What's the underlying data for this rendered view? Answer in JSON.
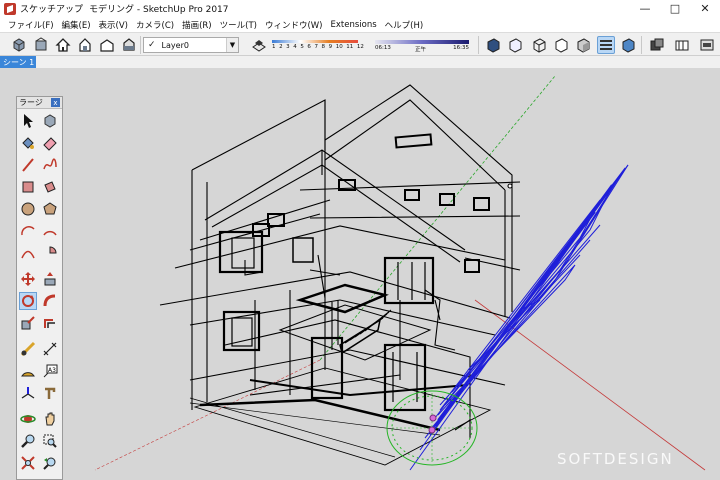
{
  "window": {
    "title_parts": [
      "スケッチアップ",
      "モデリング - SketchUp Pro 2017"
    ],
    "controls": [
      "—",
      "□",
      "✕"
    ]
  },
  "menu": [
    "ファイル(F)",
    "編集(E)",
    "表示(V)",
    "カメラ(C)",
    "描画(R)",
    "ツール(T)",
    "ウィンドウ(W)",
    "Extensions",
    "ヘルプ(H)"
  ],
  "toolbar": {
    "layer_value": "Layer0",
    "shadow_scale_labels": [
      "1",
      "2",
      "3",
      "4",
      "5",
      "6",
      "7",
      "8",
      "9",
      "10",
      "11",
      "12"
    ],
    "time_start": "06:13",
    "time_mid": "正午",
    "time_end": "16:35"
  },
  "scenes": {
    "tabs": [
      "シーン 1"
    ]
  },
  "palette": {
    "title": "ラージ",
    "close_label": "x",
    "tools": [
      "select-icon",
      "component-icon",
      "paint-bucket-icon",
      "eraser-icon",
      "line-icon",
      "freehand-icon",
      "rectangle-icon",
      "rotated-rectangle-icon",
      "circle-icon",
      "polygon-icon",
      "arc-icon",
      "two-point-arc-icon",
      "three-point-arc-icon",
      "pie-icon",
      "move-icon",
      "push-pull-icon",
      "rotate-icon",
      "follow-me-icon",
      "scale-icon",
      "offset-icon",
      "tape-measure-icon",
      "dimension-icon",
      "protractor-icon",
      "text-icon",
      "axes-icon",
      "3d-text-icon",
      "orbit-icon",
      "pan-icon",
      "zoom-icon",
      "zoom-window-icon",
      "zoom-extents-icon",
      "previous-view-icon"
    ],
    "active_tool": "rotate-icon"
  },
  "label_3d": "A3",
  "watermark": "SOFTDESIGN",
  "colors": {
    "viewport_bg": "#d6d6d6",
    "model_edges": "#000000",
    "selected_edges": "#1f1fd9",
    "rotate_gizmo": "#26b526",
    "scene_tab": "#3a86d9",
    "green_axis": "#2aa62a",
    "red_axis": "#c43a3a"
  }
}
